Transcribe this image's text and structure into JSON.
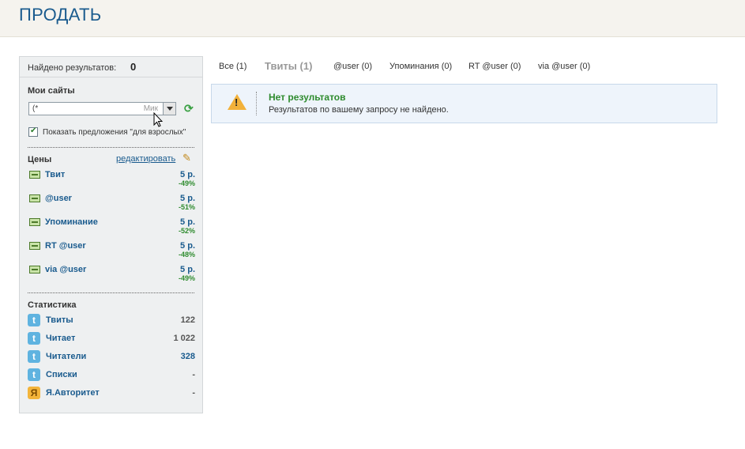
{
  "header": {
    "title": "ПРОДАТЬ"
  },
  "sidebar": {
    "found_label": "Найдено результатов:",
    "found_count": "0",
    "my_sites_title": "Мои сайты",
    "site_select_value": "(*",
    "site_select_tail": "Мик",
    "show_adult_label": "Показать предложения \"для взрослых\"",
    "prices_title": "Цены",
    "edit_label": "редактировать",
    "prices": [
      {
        "name": "Твит",
        "value": "5 р.",
        "discount": "-49%"
      },
      {
        "name": "@user",
        "value": "5 р.",
        "discount": "-51%"
      },
      {
        "name": "Упоминание",
        "value": "5 р.",
        "discount": "-52%"
      },
      {
        "name": "RT @user",
        "value": "5 р.",
        "discount": "-48%"
      },
      {
        "name": "via @user",
        "value": "5 р.",
        "discount": "-49%"
      }
    ],
    "stats_title": "Статистика",
    "stats": [
      {
        "name": "Твиты",
        "value": "122",
        "icon": "twitter-icon"
      },
      {
        "name": "Читает",
        "value": "1 022",
        "icon": "twitter-icon"
      },
      {
        "name": "Читатели",
        "value": "328",
        "icon": "twitter-icon"
      },
      {
        "name": "Списки",
        "value": "-",
        "icon": "twitter-icon"
      },
      {
        "name": "Я.Авторитет",
        "value": "-",
        "icon": "yandex-icon"
      }
    ]
  },
  "tabs": [
    {
      "label": "Все (1)"
    },
    {
      "label": "Твиты (1)"
    },
    {
      "label": "@user (0)"
    },
    {
      "label": "Упоминания (0)"
    },
    {
      "label": "RT @user (0)"
    },
    {
      "label": "via @user (0)"
    }
  ],
  "no_results": {
    "title": "Нет результатов",
    "text": "Результатов по вашему запросу не найдено."
  },
  "colors": {
    "brand_blue": "#1a5b8e",
    "success_green": "#2e8b2e",
    "warning_orange": "#f2b13a"
  }
}
